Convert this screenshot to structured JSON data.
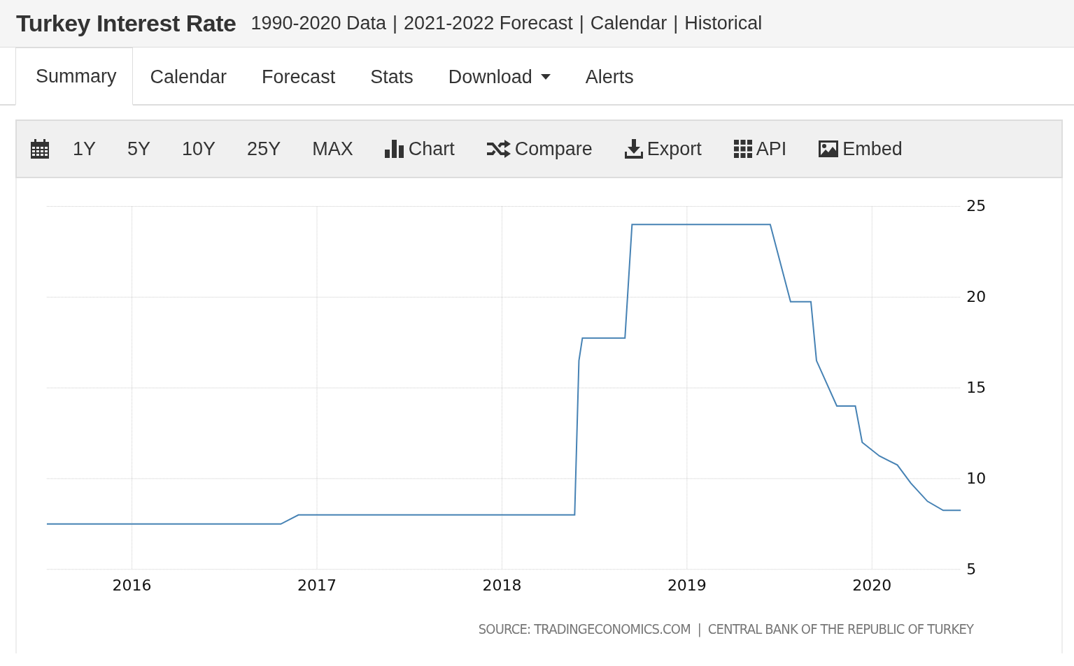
{
  "header": {
    "title": "Turkey Interest Rate",
    "links": [
      "1990-2020 Data",
      "2021-2022 Forecast",
      "Calendar",
      "Historical"
    ],
    "separator": "|"
  },
  "tabs": [
    {
      "label": "Summary",
      "selected": true,
      "dropdown": false
    },
    {
      "label": "Calendar",
      "selected": false,
      "dropdown": false
    },
    {
      "label": "Forecast",
      "selected": false,
      "dropdown": false
    },
    {
      "label": "Stats",
      "selected": false,
      "dropdown": false
    },
    {
      "label": "Download",
      "selected": false,
      "dropdown": true
    },
    {
      "label": "Alerts",
      "selected": false,
      "dropdown": false
    }
  ],
  "toolbar": {
    "ranges": [
      "1Y",
      "5Y",
      "10Y",
      "25Y",
      "MAX"
    ],
    "actions": [
      "Chart",
      "Compare",
      "Export",
      "API",
      "Embed"
    ]
  },
  "chart": {
    "source": "SOURCE: TRADINGECONOMICS.COM  |  CENTRAL BANK OF THE REPUBLIC OF TURKEY",
    "chart_data": {
      "type": "line",
      "x": [
        2015.54,
        2016.805,
        2016.9,
        2018.393,
        2018.416,
        2018.435,
        2018.665,
        2018.703,
        2019.45,
        2019.56,
        2019.67,
        2019.7,
        2019.81,
        2019.91,
        2019.947,
        2020.04,
        2020.137,
        2020.21,
        2020.3,
        2020.385,
        2020.48
      ],
      "series": [
        {
          "color": "#4682b4",
          "values": [
            7.5,
            7.5,
            8,
            8,
            16.5,
            17.75,
            17.75,
            24,
            24,
            19.75,
            19.75,
            16.5,
            14,
            14,
            12,
            11.25,
            10.75,
            9.75,
            8.75,
            8.25,
            8.25
          ]
        }
      ],
      "grid": true,
      "xlim": [
        2015.54,
        2020.48
      ],
      "ylim": [
        5,
        25
      ],
      "xticks": [
        2016,
        2017,
        2018,
        2019,
        2020
      ],
      "yticks": [
        5,
        10,
        15,
        20,
        25
      ]
    }
  }
}
